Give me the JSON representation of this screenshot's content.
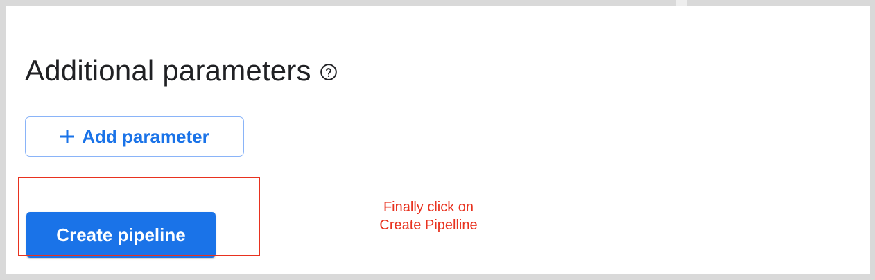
{
  "section": {
    "title": "Additional parameters",
    "help_icon": "help-circle-icon"
  },
  "buttons": {
    "add_parameter": {
      "icon": "plus-icon",
      "label": "Add parameter"
    },
    "create_pipeline": {
      "label": "Create pipeline"
    }
  },
  "annotation": {
    "line1": "Finally click on",
    "line2": "Create Pipelline"
  },
  "colors": {
    "primary_blue": "#1a73e8",
    "outline_blue": "#8ab4f8",
    "annotation_red": "#e8321f",
    "title_text": "#202124",
    "frame_gray": "#d9d9d9"
  }
}
